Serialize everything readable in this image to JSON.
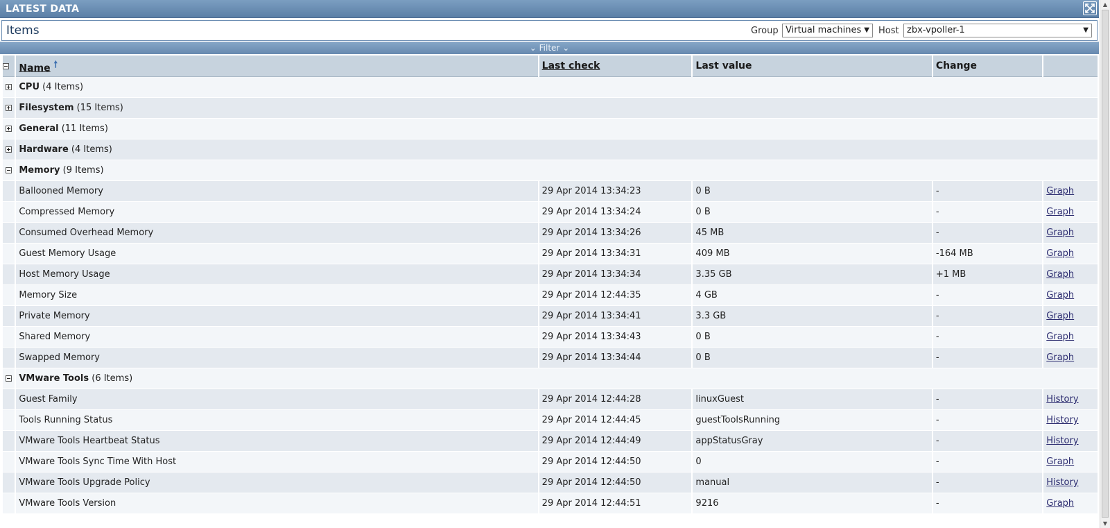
{
  "title": "LATEST DATA",
  "items_bar": {
    "title": "Items",
    "group_label": "Group",
    "group_value": "Virtual machines",
    "host_label": "Host",
    "host_value": "zbx-vpoller-1"
  },
  "filter_label": "Filter",
  "columns": {
    "name": "Name",
    "last_check": "Last check",
    "last_value": "Last value",
    "change": "Change"
  },
  "groups": [
    {
      "name": "CPU",
      "count": "(4 Items)",
      "expanded": false,
      "items": []
    },
    {
      "name": "Filesystem",
      "count": "(15 Items)",
      "expanded": false,
      "items": []
    },
    {
      "name": "General",
      "count": "(11 Items)",
      "expanded": false,
      "items": []
    },
    {
      "name": "Hardware",
      "count": "(4 Items)",
      "expanded": false,
      "items": []
    },
    {
      "name": "Memory",
      "count": "(9 Items)",
      "expanded": true,
      "items": [
        {
          "name": "Ballooned Memory",
          "last_check": "29 Apr 2014 13:34:23",
          "last_value": "0 B",
          "change": "-",
          "link": "Graph"
        },
        {
          "name": "Compressed Memory",
          "last_check": "29 Apr 2014 13:34:24",
          "last_value": "0 B",
          "change": "-",
          "link": "Graph"
        },
        {
          "name": "Consumed Overhead Memory",
          "last_check": "29 Apr 2014 13:34:26",
          "last_value": "45 MB",
          "change": "-",
          "link": "Graph"
        },
        {
          "name": "Guest Memory Usage",
          "last_check": "29 Apr 2014 13:34:31",
          "last_value": "409 MB",
          "change": "-164 MB",
          "link": "Graph"
        },
        {
          "name": "Host Memory Usage",
          "last_check": "29 Apr 2014 13:34:34",
          "last_value": "3.35 GB",
          "change": "+1 MB",
          "link": "Graph"
        },
        {
          "name": "Memory Size",
          "last_check": "29 Apr 2014 12:44:35",
          "last_value": "4 GB",
          "change": "-",
          "link": "Graph"
        },
        {
          "name": "Private Memory",
          "last_check": "29 Apr 2014 13:34:41",
          "last_value": "3.3 GB",
          "change": "-",
          "link": "Graph"
        },
        {
          "name": "Shared Memory",
          "last_check": "29 Apr 2014 13:34:43",
          "last_value": "0 B",
          "change": "-",
          "link": "Graph"
        },
        {
          "name": "Swapped Memory",
          "last_check": "29 Apr 2014 13:34:44",
          "last_value": "0 B",
          "change": "-",
          "link": "Graph"
        }
      ]
    },
    {
      "name": "VMware Tools",
      "count": "(6 Items)",
      "expanded": true,
      "items": [
        {
          "name": "Guest Family",
          "last_check": "29 Apr 2014 12:44:28",
          "last_value": "linuxGuest",
          "change": "-",
          "link": "History"
        },
        {
          "name": "Tools Running Status",
          "last_check": "29 Apr 2014 12:44:45",
          "last_value": "guestToolsRunning",
          "change": "-",
          "link": "History"
        },
        {
          "name": "VMware Tools Heartbeat Status",
          "last_check": "29 Apr 2014 12:44:49",
          "last_value": "appStatusGray",
          "change": "-",
          "link": "History"
        },
        {
          "name": "VMware Tools Sync Time With Host",
          "last_check": "29 Apr 2014 12:44:50",
          "last_value": "0",
          "change": "-",
          "link": "Graph"
        },
        {
          "name": "VMware Tools Upgrade Policy",
          "last_check": "29 Apr 2014 12:44:50",
          "last_value": "manual",
          "change": "-",
          "link": "History"
        },
        {
          "name": "VMware Tools Version",
          "last_check": "29 Apr 2014 12:44:51",
          "last_value": "9216",
          "change": "-",
          "link": "Graph"
        }
      ]
    }
  ]
}
